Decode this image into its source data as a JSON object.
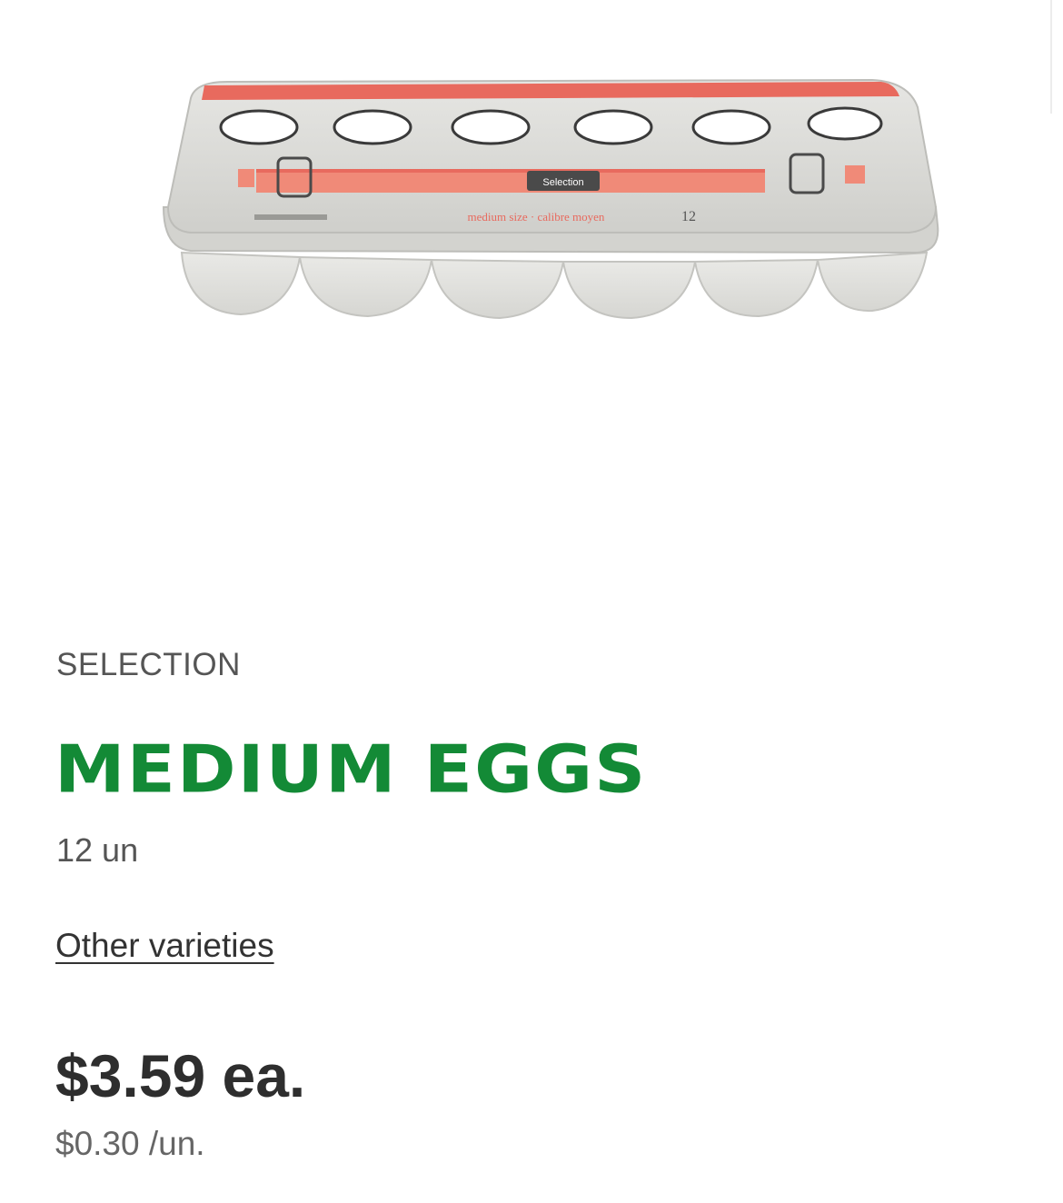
{
  "product": {
    "image_alt": "Selection medium eggs, 12 pack carton",
    "carton_text": {
      "logo": "Selection",
      "size_line": "medium size · calibre moyen",
      "count": "12"
    },
    "brand": "SELECTION",
    "name": "MEDIUM EGGS",
    "size": "12 un",
    "other_varieties_label": "Other varieties",
    "price": "$3.59 ea.",
    "unit_price": "$0.30 /un."
  },
  "colors": {
    "title_green": "#138a36",
    "carton_gray": "#d9d9d6",
    "carton_stripe": "#f08a78"
  }
}
